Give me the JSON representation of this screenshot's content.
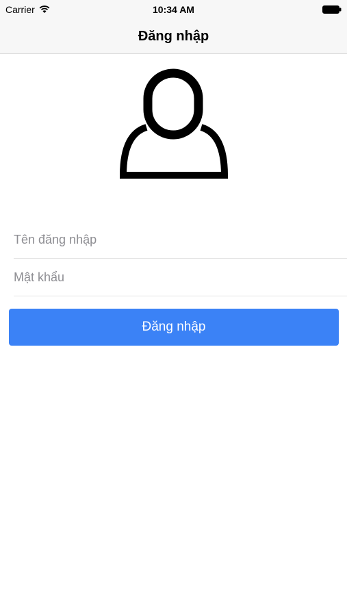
{
  "status_bar": {
    "carrier": "Carrier",
    "time": "10:34 AM",
    "wifi_icon": "wifi-icon",
    "battery_icon": "battery-icon"
  },
  "nav": {
    "title": "Đăng nhập"
  },
  "avatar": {
    "icon": "user-avatar-icon"
  },
  "form": {
    "username_placeholder": "Tên đăng nhập",
    "username_value": "",
    "password_placeholder": "Mật khẩu",
    "password_value": "",
    "login_label": "Đăng nhập"
  },
  "colors": {
    "accent": "#3b82f6",
    "bar_background": "#f7f7f7"
  }
}
